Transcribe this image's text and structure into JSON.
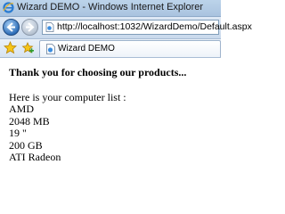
{
  "window": {
    "title": "Wizard DEMO - Windows Internet Explorer"
  },
  "address_bar": {
    "url": "http://localhost:1032/WizardDemo/Default.aspx"
  },
  "tab": {
    "label": "Wizard DEMO"
  },
  "content": {
    "thanks": "Thank you for choosing our products...",
    "list_heading": "Here is your computer list :",
    "items": [
      "AMD",
      "2048 MB",
      "19 \"",
      "200 GB",
      "ATI Radeon"
    ]
  }
}
